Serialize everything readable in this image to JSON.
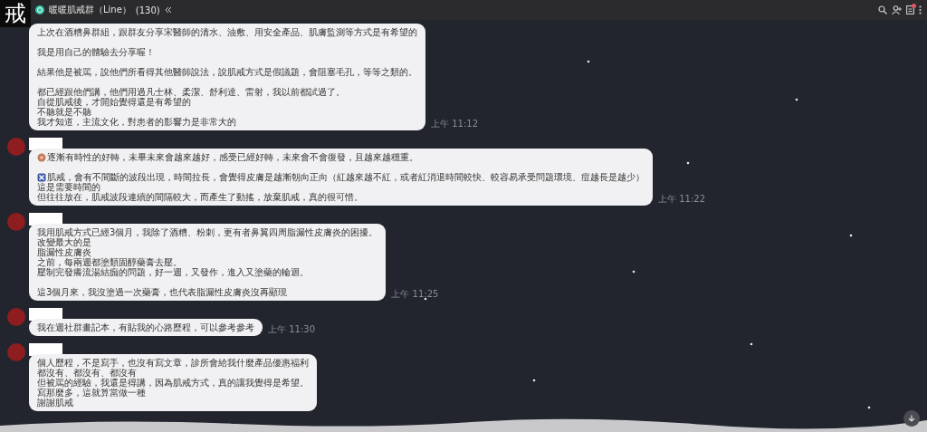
{
  "header": {
    "logo": "戒",
    "title": "暖暖肌戒群（Line）",
    "member_count": "(130)",
    "notification_badge": true
  },
  "messages": [
    {
      "avatar": false,
      "name_redacted": false,
      "time": "上午 11:12",
      "lines": [
        {
          "text": "上次在酒糟鼻群組，跟群友分享宋醫師的清水、油敷、用安全產品、肌膚監測等方式是有希望的"
        },
        {
          "kind": "blank"
        },
        {
          "text": "我是用自己的體驗去分享喔！"
        },
        {
          "kind": "blank"
        },
        {
          "text": "結果他是被罵，說他們所看得其他醫師說法，說肌戒方式是假議題，會阻塞毛孔，等等之類的。"
        },
        {
          "kind": "blank"
        },
        {
          "text": "都已經跟他們講，他們用過凡士林、柔潔、舒利達、雷射，我以前都試過了。"
        },
        {
          "text": "自從肌戒後，才開始覺得還是有希望的"
        },
        {
          "text": "不聽就是不聽"
        },
        {
          "text": "我才知道，主流文化，對患者的影響力是非常大的"
        }
      ]
    },
    {
      "avatar": true,
      "name_redacted": true,
      "time": "上午 11:22",
      "lines": [
        {
          "kind": "flower",
          "text": "逐漸有時性的好轉，未畢未來會越來越好，感受已經好轉，未來會不會復發，且越來越穩重。"
        },
        {
          "kind": "blank"
        },
        {
          "kind": "cross",
          "text": "肌戒，會有不間斷的波段出現，時間拉長，會覺得皮膚是越漸朝向正向（紅越來越不紅，或者紅消退時間較快、較容易承受問題環境、痘越長是越少）"
        },
        {
          "text": "這是需要時間的"
        },
        {
          "text": "但往往放在，肌戒波段連續的間隔較大，而產生了動搖，放棄肌戒，真的很可惜。"
        }
      ]
    },
    {
      "avatar": true,
      "name_redacted": true,
      "time": "上午 11:25",
      "lines": [
        {
          "text": "我用肌戒方式已經3個月，我除了酒糟、粉刺，更有者鼻翼四周脂漏性皮膚炎的困擾。"
        },
        {
          "text": "改變最大的是"
        },
        {
          "text": "脂漏性皮膚炎"
        },
        {
          "text": "之前，每兩週都塗類固醇藥膏去壓。"
        },
        {
          "text": "壓制完發癢流湯結痂的問題，好一週，又發作，進入又塗藥的輪迴。"
        },
        {
          "kind": "blank"
        },
        {
          "text": "這3個月來，我沒塗過一次藥膏，也代表脂漏性皮膚炎沒再顯現"
        }
      ]
    },
    {
      "avatar": true,
      "name_redacted": true,
      "time": "上午 11:30",
      "lines": [
        {
          "text": "我在週社群畫記本，有貼我的心路歷程，可以參考參考"
        }
      ]
    },
    {
      "avatar": true,
      "name_redacted": true,
      "lines": [
        {
          "text": "個人歷程，不是寫手，也沒有寫文章，診所會給我什麼產品優惠福利"
        },
        {
          "text": "都沒有、都沒有、都沒有"
        },
        {
          "text": "但被罵的經驗，我還是得講，因為肌戒方式，真的讓我覺得是希望。"
        },
        {
          "text": "寫那麼多，這就算當做一種"
        },
        {
          "text": "謝謝肌戒"
        }
      ]
    }
  ]
}
